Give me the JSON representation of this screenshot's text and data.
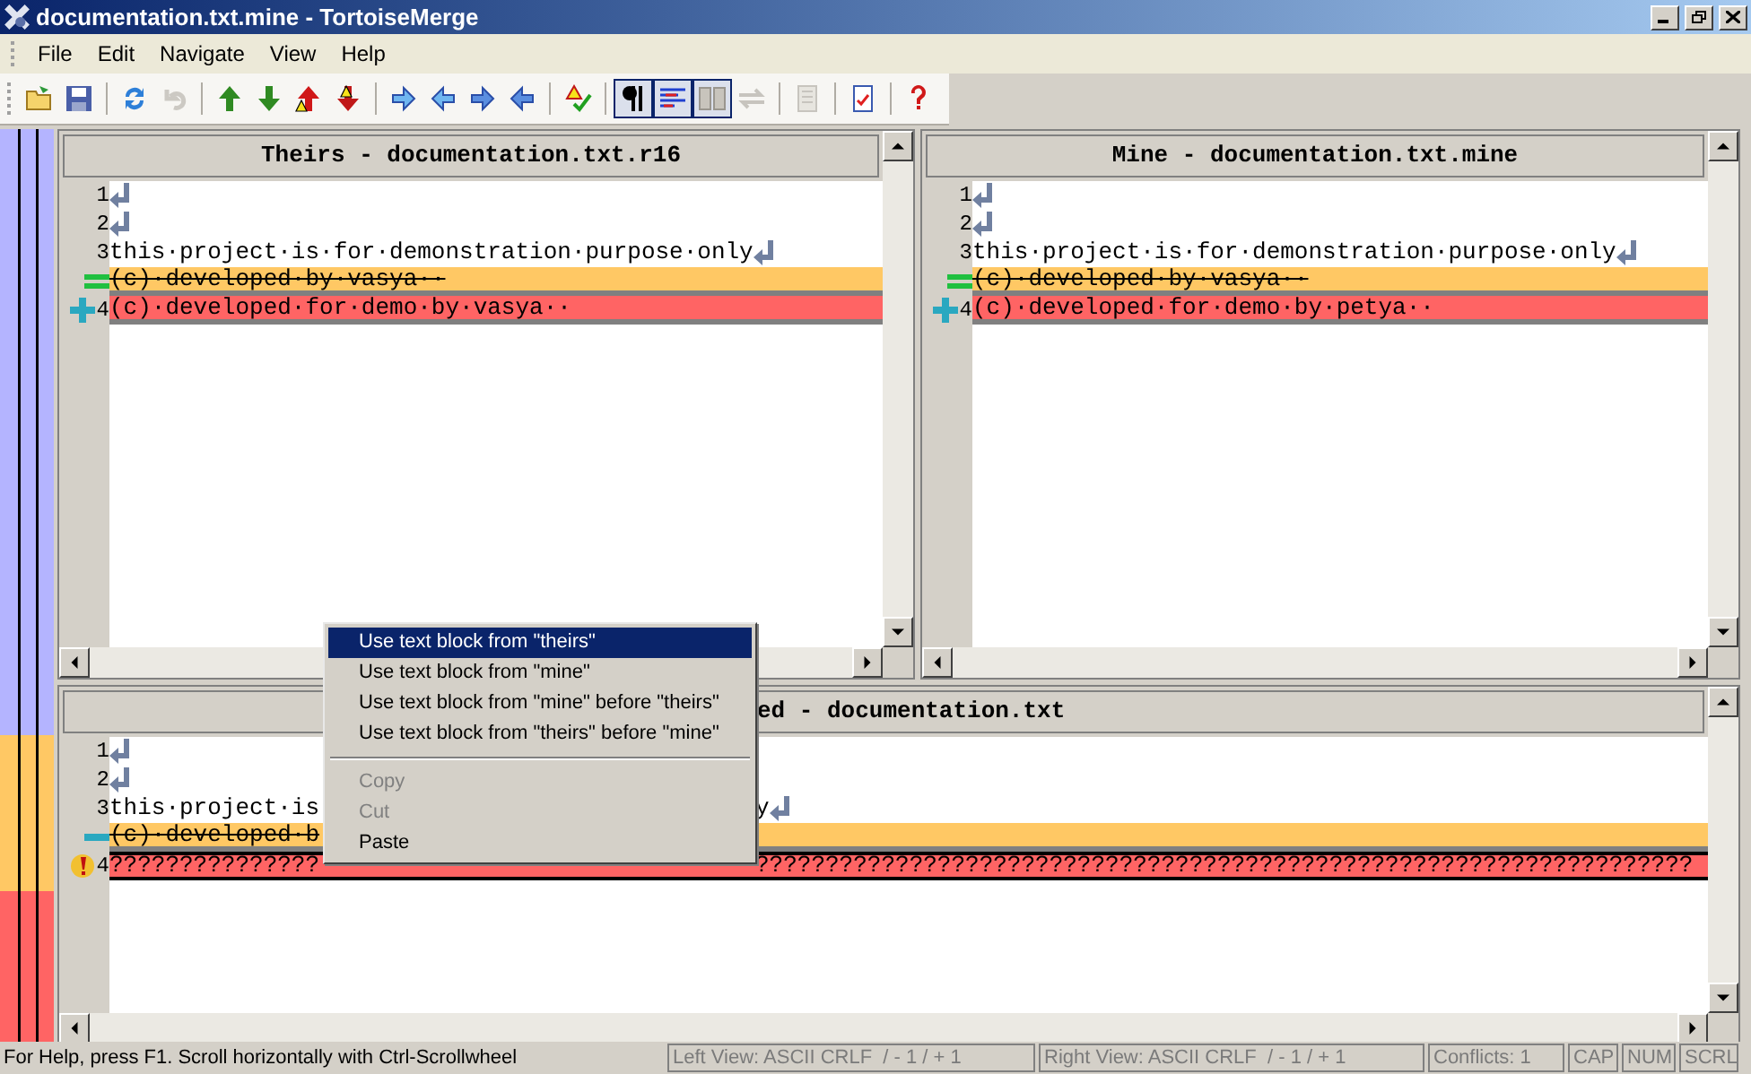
{
  "window": {
    "title": "documentation.txt.mine - TortoiseMerge"
  },
  "menu": [
    "File",
    "Edit",
    "Navigate",
    "View",
    "Help"
  ],
  "toolbar": [
    [
      {
        "pressed": false,
        "disabled": false
      },
      {
        "pressed": false,
        "disabled": false
      }
    ],
    [
      {
        "pressed": false,
        "disabled": false
      },
      {
        "pressed": false,
        "disabled": true
      }
    ],
    [
      {
        "pressed": false,
        "disabled": false
      },
      {
        "pressed": false,
        "disabled": false
      },
      {
        "pressed": false,
        "disabled": false
      },
      {
        "pressed": false,
        "disabled": false
      }
    ],
    [
      {
        "pressed": false,
        "disabled": false
      },
      {
        "pressed": false,
        "disabled": false
      },
      {
        "pressed": false,
        "disabled": false
      },
      {
        "pressed": false,
        "disabled": false
      }
    ],
    [
      {
        "pressed": false,
        "disabled": false
      }
    ],
    [
      {
        "pressed": true,
        "disabled": false
      },
      {
        "pressed": true,
        "disabled": false
      },
      {
        "pressed": true,
        "disabled": false
      },
      {
        "pressed": false,
        "disabled": true
      }
    ],
    [
      {
        "pressed": false,
        "disabled": true
      }
    ],
    [
      {
        "pressed": false,
        "disabled": false
      }
    ],
    [
      {
        "pressed": false,
        "disabled": false
      }
    ]
  ],
  "panes": [
    {
      "title": "Theirs - documentation.txt.r16",
      "lines": [
        {
          "number": "1",
          "kind": "normal",
          "eol": true
        },
        {
          "number": "2",
          "kind": "normal",
          "eol": true
        },
        {
          "number": "3",
          "text": "this·project·is·for·demonstration·purpose·only",
          "kind": "normal",
          "eol": true
        },
        {
          "text": "(c)·developed·by·vasya··",
          "kind": "removed",
          "eol": false
        },
        {
          "number": "4",
          "text": "(c)·developed·for·demo·by·vasya··",
          "kind": "added",
          "eol": false
        }
      ]
    },
    {
      "title": "Mine - documentation.txt.mine",
      "lines": [
        {
          "number": "1",
          "kind": "normal",
          "eol": true
        },
        {
          "number": "2",
          "kind": "normal",
          "eol": true
        },
        {
          "number": "3",
          "text": "this·project·is·for·demonstration·purpose·only",
          "kind": "normal",
          "eol": true
        },
        {
          "text": "(c)·developed·by·vasya··",
          "kind": "removed",
          "eol": false
        },
        {
          "number": "4",
          "text": "(c)·developed·for·demo·by·petya··",
          "kind": "added",
          "eol": false
        }
      ]
    }
  ],
  "merged_pane": {
    "title": "ed - documentation.txt",
    "lines": [
      {
        "number": "1",
        "kind": "normal",
        "eol": true
      },
      {
        "number": "2",
        "kind": "normal",
        "eol": true
      },
      {
        "number": "3",
        "text": "this·project·is",
        "text_right": "y",
        "kind": "normal",
        "eol": true
      },
      {
        "text": "(c)·developed·b",
        "kind": "deleted",
        "eol": false
      },
      {
        "number": "4",
        "text": "???????????????",
        "text_right": "???????????????????????????????????????????????????????????????????",
        "kind": "conflict",
        "eol": false
      }
    ]
  },
  "context_menu": [
    {
      "kind": "item",
      "label": "Use text block from \"theirs\"",
      "selected": true,
      "disabled": false
    },
    {
      "kind": "item",
      "label": "Use text block from \"mine\"",
      "selected": false,
      "disabled": false
    },
    {
      "kind": "item",
      "label": "Use text block from \"mine\" before \"theirs\"",
      "selected": false,
      "disabled": false
    },
    {
      "kind": "item",
      "label": "Use text block from \"theirs\" before \"mine\"",
      "selected": false,
      "disabled": false
    },
    {
      "kind": "separator"
    },
    {
      "kind": "item",
      "label": "Copy",
      "selected": false,
      "disabled": true
    },
    {
      "kind": "item",
      "label": "Cut",
      "selected": false,
      "disabled": true
    },
    {
      "kind": "item",
      "label": "Paste",
      "selected": false,
      "disabled": false
    }
  ],
  "status_bar": {
    "help": "For Help, press F1. Scroll horizontally with Ctrl-Scrollwheel",
    "panes": [
      "Left View: ASCII CRLF  / - 1 / + 1",
      "Right View: ASCII CRLF  / - 1 / + 1",
      "Conflicts: 1",
      "CAP",
      "NUM",
      "SCRL"
    ]
  }
}
